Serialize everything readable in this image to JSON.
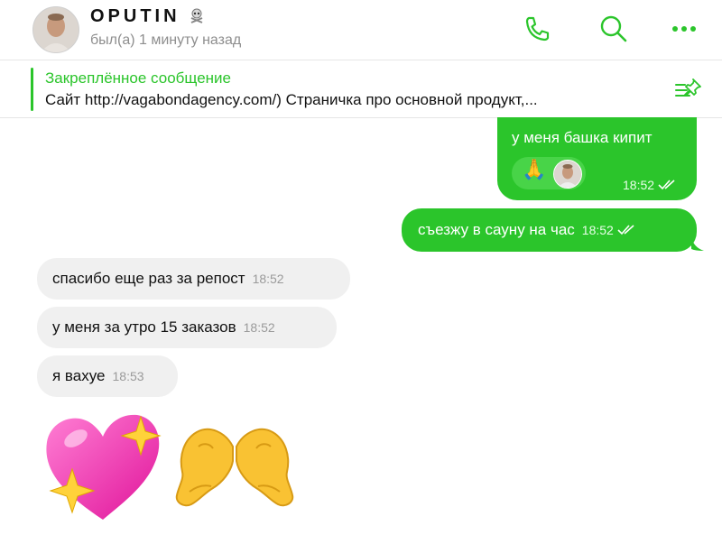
{
  "header": {
    "contact_name": "OPUTIN",
    "contact_status": "был(а) 1 минуту назад"
  },
  "pinned": {
    "title": "Закреплённое сообщение",
    "text": "Сайт  http://vagabondagency.com/)  Страничка про основной продукт,..."
  },
  "messages": [
    {
      "direction": "out",
      "text": "у меня башка кипит",
      "time": "18:52",
      "reaction": "🙏"
    },
    {
      "direction": "out",
      "text": "съезжу в сауну на час",
      "time": "18:52"
    },
    {
      "direction": "in",
      "text": "спасибо еще раз за репост",
      "time": "18:52"
    },
    {
      "direction": "in",
      "text": "у меня за утро 15 заказов",
      "time": "18:52"
    },
    {
      "direction": "in",
      "text": "я вахуе",
      "time": "18:53"
    }
  ],
  "stickers": [
    "sparkling-heart",
    "heart-hands"
  ],
  "colors": {
    "accent": "#2bc52b",
    "incoming_bubble": "#f0f0f0",
    "outgoing_bubble": "#2bc52b"
  }
}
